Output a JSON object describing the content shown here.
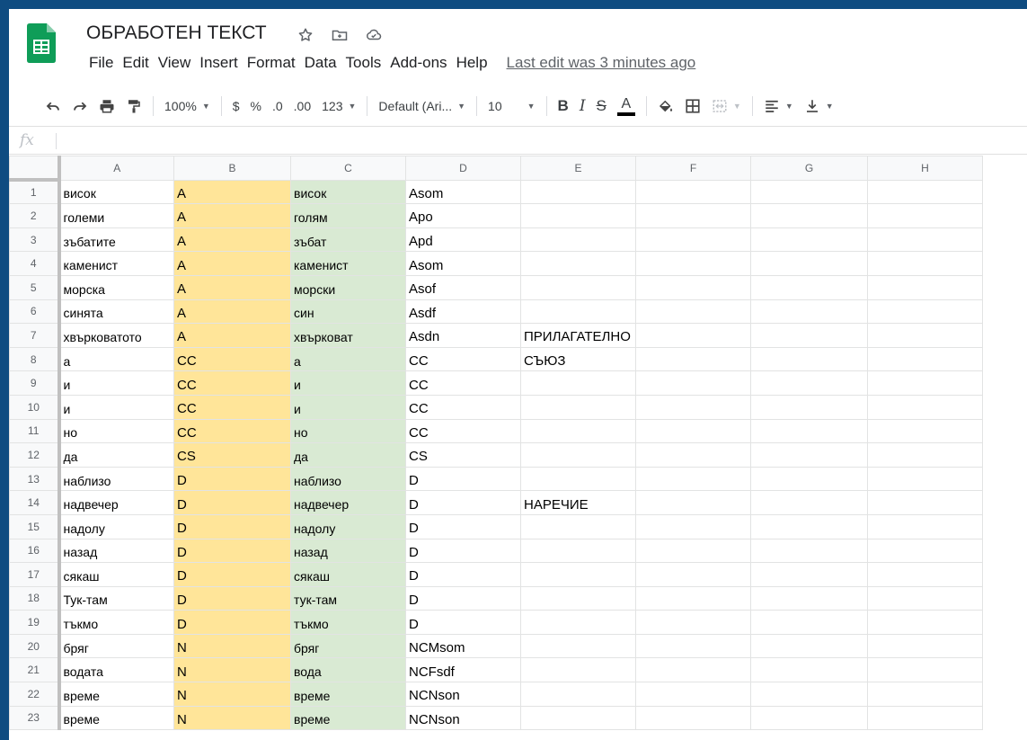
{
  "document": {
    "title": "ОБРАБОТЕН ТЕКСТ",
    "last_edit": "Last edit was 3 minutes ago"
  },
  "menu": [
    "File",
    "Edit",
    "View",
    "Insert",
    "Format",
    "Data",
    "Tools",
    "Add-ons",
    "Help"
  ],
  "toolbar": {
    "zoom": "100%",
    "currency": "$",
    "percent": "%",
    "decrease_decimals": ".0",
    "increase_decimals": ".00",
    "more_formats": "123",
    "font": "Default (Ari...",
    "font_size": "10",
    "bold": "B",
    "italic": "I",
    "strikethrough": "S",
    "text_color": "A"
  },
  "formula_bar": {
    "label": "fx",
    "value": ""
  },
  "columns": [
    "A",
    "B",
    "C",
    "D",
    "E",
    "F",
    "G",
    "H"
  ],
  "rows": [
    {
      "num": "1",
      "cells": [
        "висок",
        "A",
        "висок",
        "Asom",
        "",
        "",
        "",
        ""
      ]
    },
    {
      "num": "2",
      "cells": [
        "големи",
        "A",
        "голям",
        "Apo",
        "",
        "",
        "",
        ""
      ]
    },
    {
      "num": "3",
      "cells": [
        "зъбатите",
        "A",
        "зъбат",
        "Apd",
        "",
        "",
        "",
        ""
      ]
    },
    {
      "num": "4",
      "cells": [
        "каменист",
        "A",
        "каменист",
        "Asom",
        "",
        "",
        "",
        ""
      ]
    },
    {
      "num": "5",
      "cells": [
        "морска",
        "A",
        "морски",
        "Asof",
        "",
        "",
        "",
        ""
      ]
    },
    {
      "num": "6",
      "cells": [
        "синята",
        "A",
        "син",
        "Asdf",
        "",
        "",
        "",
        ""
      ]
    },
    {
      "num": "7",
      "cells": [
        "хвърковатото",
        "A",
        "хвърковат",
        "Asdn",
        "ПРИЛАГАТЕЛНО",
        "",
        "",
        ""
      ]
    },
    {
      "num": "8",
      "cells": [
        "а",
        "CC",
        "а",
        "CC",
        "СЪЮЗ",
        "",
        "",
        ""
      ]
    },
    {
      "num": "9",
      "cells": [
        "и",
        "CC",
        "и",
        "CC",
        "",
        "",
        "",
        ""
      ]
    },
    {
      "num": "10",
      "cells": [
        "и",
        "CC",
        "и",
        "CC",
        "",
        "",
        "",
        ""
      ]
    },
    {
      "num": "11",
      "cells": [
        "но",
        "CC",
        "но",
        "CC",
        "",
        "",
        "",
        ""
      ]
    },
    {
      "num": "12",
      "cells": [
        "да",
        "CS",
        "да",
        "CS",
        "",
        "",
        "",
        ""
      ]
    },
    {
      "num": "13",
      "cells": [
        "наблизо",
        "D",
        "наблизо",
        "D",
        "",
        "",
        "",
        ""
      ]
    },
    {
      "num": "14",
      "cells": [
        "надвечер",
        "D",
        "надвечер",
        "D",
        "НАРЕЧИЕ",
        "",
        "",
        ""
      ]
    },
    {
      "num": "15",
      "cells": [
        "надолу",
        "D",
        "надолу",
        "D",
        "",
        "",
        "",
        ""
      ]
    },
    {
      "num": "16",
      "cells": [
        "назад",
        "D",
        "назад",
        "D",
        "",
        "",
        "",
        ""
      ]
    },
    {
      "num": "17",
      "cells": [
        "сякаш",
        "D",
        "сякаш",
        "D",
        "",
        "",
        "",
        ""
      ]
    },
    {
      "num": "18",
      "cells": [
        "Тук-там",
        "D",
        "тук-там",
        "D",
        "",
        "",
        "",
        ""
      ]
    },
    {
      "num": "19",
      "cells": [
        "тъкмо",
        "D",
        "тъкмо",
        "D",
        "",
        "",
        "",
        ""
      ]
    },
    {
      "num": "20",
      "cells": [
        "бряг",
        "N",
        "бряг",
        "NCMsom",
        "",
        "",
        "",
        ""
      ]
    },
    {
      "num": "21",
      "cells": [
        "водата",
        "N",
        "вода",
        "NCFsdf",
        "",
        "",
        "",
        ""
      ]
    },
    {
      "num": "22",
      "cells": [
        "време",
        "N",
        "време",
        "NCNson",
        "",
        "",
        "",
        ""
      ]
    },
    {
      "num": "23",
      "cells": [
        "време",
        "N",
        "време",
        "NCNson",
        "",
        "",
        "",
        ""
      ]
    }
  ],
  "colors": {
    "column_b_fill": "#ffe599",
    "column_c_fill": "#d9ead3",
    "sheets_green": "#0f9d58",
    "frame": "#0f4c81"
  }
}
